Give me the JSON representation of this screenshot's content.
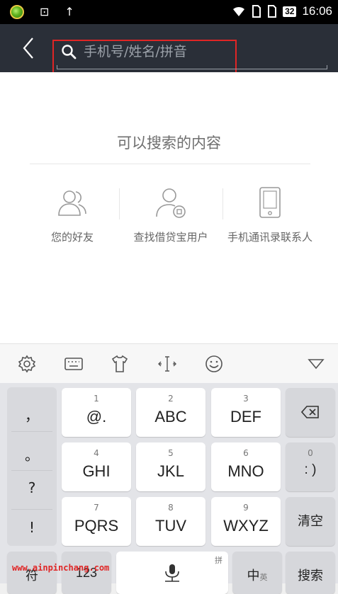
{
  "status_bar": {
    "time": "16:06",
    "battery": "32"
  },
  "search": {
    "placeholder": "手机号/姓名/拼音",
    "value": ""
  },
  "content": {
    "heading": "可以搜索的内容",
    "options": [
      {
        "label": "您的好友",
        "icon": "friends-icon"
      },
      {
        "label": "查找借贷宝用户",
        "icon": "user-search-icon"
      },
      {
        "label": "手机通讯录联系人",
        "icon": "phone-contacts-icon"
      }
    ]
  },
  "keyboard": {
    "toolbar_icons": [
      "settings-icon",
      "keyboard-icon",
      "shirt-icon",
      "cursor-icon",
      "emoji-icon",
      "collapse-icon"
    ],
    "side_keys": [
      "，",
      "。",
      "?",
      "!"
    ],
    "keys": [
      {
        "num": "1",
        "label": "@."
      },
      {
        "num": "2",
        "label": "ABC"
      },
      {
        "num": "3",
        "label": "DEF"
      },
      {
        "num": "4",
        "label": "GHI"
      },
      {
        "num": "5",
        "label": "JKL"
      },
      {
        "num": "6",
        "label": "MNO"
      },
      {
        "num": "7",
        "label": "PQRS"
      },
      {
        "num": "8",
        "label": "TUV"
      },
      {
        "num": "9",
        "label": "WXYZ"
      }
    ],
    "zero_key": {
      "num": "0",
      "label": ": )"
    },
    "clear_label": "清空",
    "bottom": {
      "symbol_label": "符",
      "num_label": "123",
      "space_hint": "拼",
      "lang_label": "中",
      "lang_sub": "英",
      "search_label": "搜索"
    }
  },
  "watermark": "www.ainpinchang.com"
}
